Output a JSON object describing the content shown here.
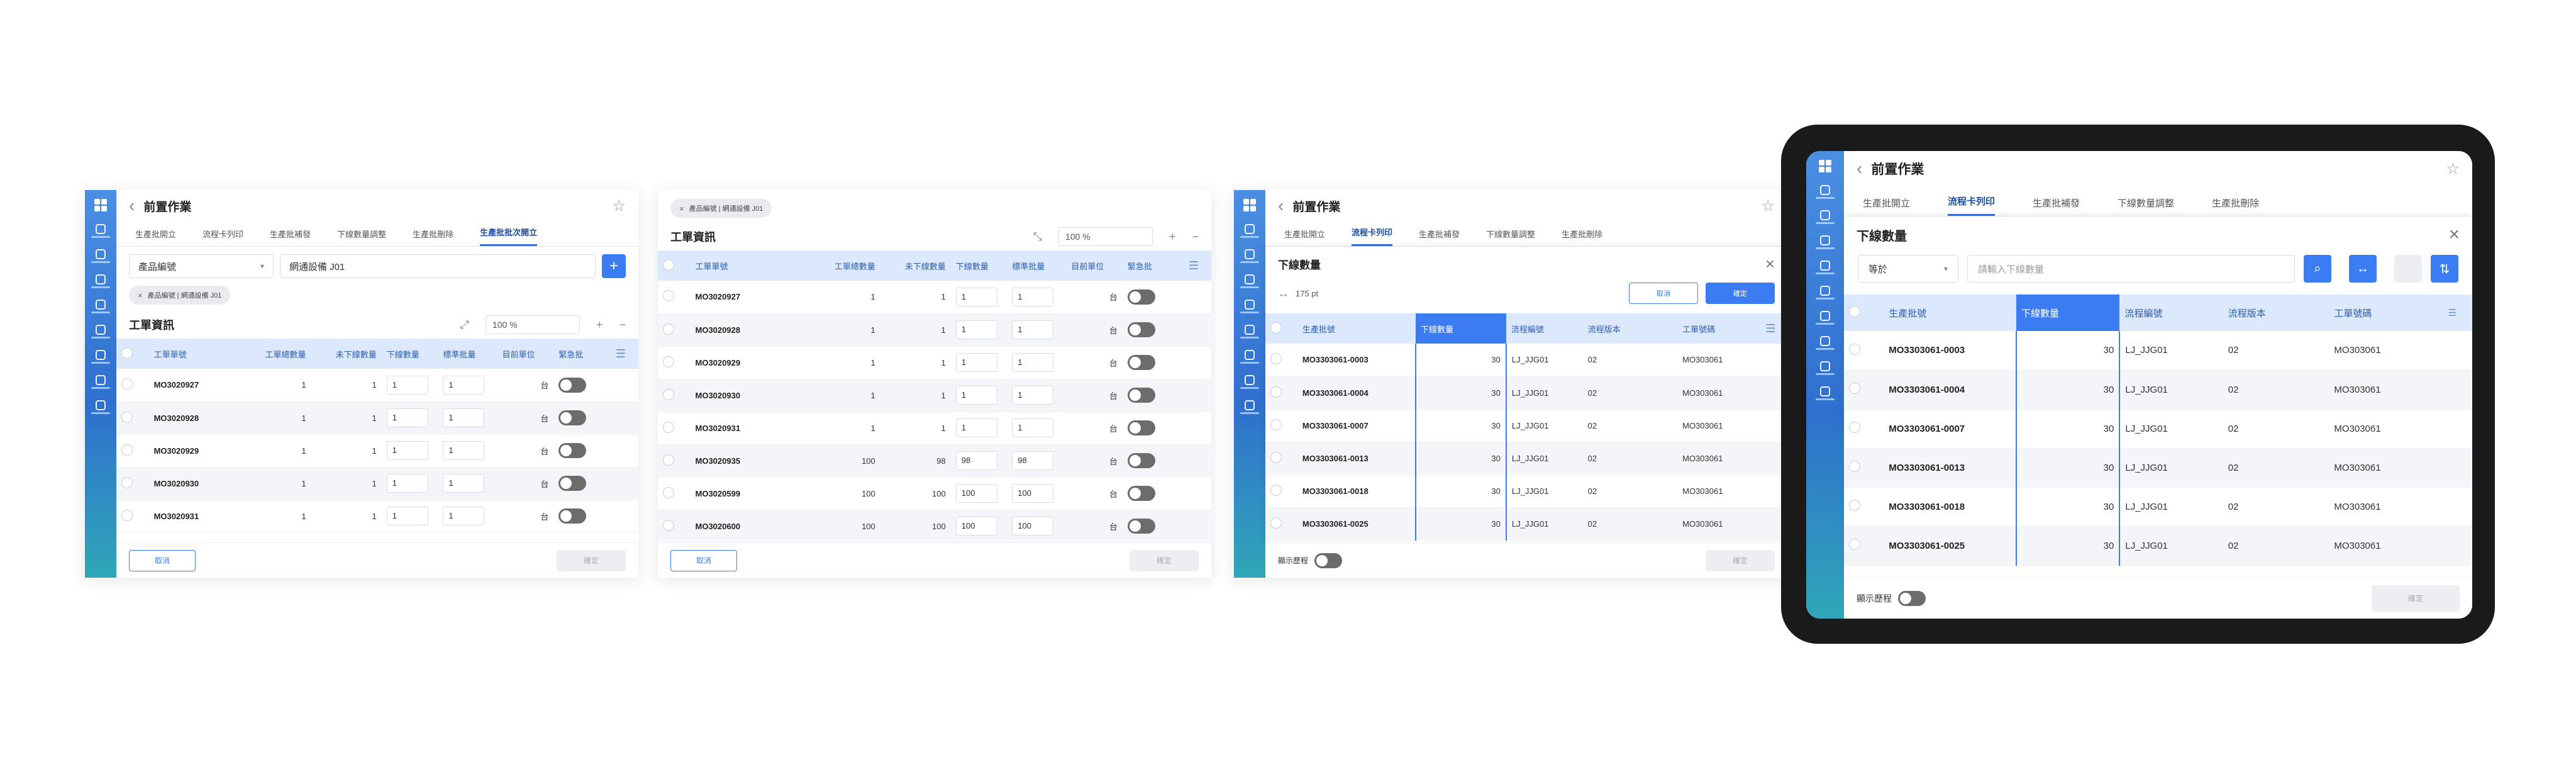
{
  "app": {
    "page_title": "前置作業",
    "tabs": [
      "生產批開立",
      "流程卡列印",
      "生產批補發",
      "下線數量調整",
      "生產批刪除",
      "生產批批次開立"
    ]
  },
  "panel1": {
    "filter_select": "產品編號",
    "filter_value": "網通設備 J01",
    "chip": "產品編號 | 網通設備 J01",
    "section_title": "工單資訊",
    "zoom": "100 %",
    "columns": [
      "工單單號",
      "工單總數量",
      "未下線數量",
      "下線數量",
      "標準批量",
      "目前單位",
      "緊急批"
    ],
    "rows": [
      [
        "MO3020927",
        "1",
        "1",
        "1",
        "1",
        "台"
      ],
      [
        "MO3020928",
        "1",
        "1",
        "1",
        "1",
        "台"
      ],
      [
        "MO3020929",
        "1",
        "1",
        "1",
        "1",
        "台"
      ],
      [
        "MO3020930",
        "1",
        "1",
        "1",
        "1",
        "台"
      ],
      [
        "MO3020931",
        "1",
        "1",
        "1",
        "1",
        "台"
      ]
    ],
    "footer_left": "取消",
    "footer_right": "確定"
  },
  "panel2": {
    "chip": "產品編號 | 網通設備 J01",
    "section_title": "工單資訊",
    "zoom": "100 %",
    "columns": [
      "工單單號",
      "工單總數量",
      "未下線數量",
      "下線數量",
      "標準批量",
      "目前單位",
      "緊急批"
    ],
    "rows": [
      [
        "MO3020927",
        "1",
        "1",
        "1",
        "1",
        "台"
      ],
      [
        "MO3020928",
        "1",
        "1",
        "1",
        "1",
        "台"
      ],
      [
        "MO3020929",
        "1",
        "1",
        "1",
        "1",
        "台"
      ],
      [
        "MO3020930",
        "1",
        "1",
        "1",
        "1",
        "台"
      ],
      [
        "MO3020931",
        "1",
        "1",
        "1",
        "1",
        "台"
      ],
      [
        "MO3020935",
        "100",
        "98",
        "98",
        "98",
        "台"
      ],
      [
        "MO3020599",
        "100",
        "100",
        "100",
        "100",
        "台"
      ],
      [
        "MO3020600",
        "100",
        "100",
        "100",
        "100",
        "台"
      ]
    ],
    "footer_left": "取消",
    "footer_right": "確定"
  },
  "panel3": {
    "qty_title": "下線數量",
    "width_value": "175 pt",
    "cancel": "取消",
    "confirm": "確定",
    "columns": [
      "生產批號",
      "下線數量",
      "流程編號",
      "流程版本",
      "工單號碼"
    ],
    "rows": [
      [
        "MO3303061-0003",
        "30",
        "LJ_JJG01",
        "02",
        "MO303061"
      ],
      [
        "MO3303061-0004",
        "30",
        "LJ_JJG01",
        "02",
        "MO303061"
      ],
      [
        "MO3303061-0007",
        "30",
        "LJ_JJG01",
        "02",
        "MO303061"
      ],
      [
        "MO3303061-0013",
        "30",
        "LJ_JJG01",
        "02",
        "MO303061"
      ],
      [
        "MO3303061-0018",
        "30",
        "LJ_JJG01",
        "02",
        "MO303061"
      ],
      [
        "MO3303061-0025",
        "30",
        "LJ_JJG01",
        "02",
        "MO303061"
      ]
    ],
    "history": "顯示歷程",
    "footer_right": "確定"
  },
  "tablet": {
    "qty_title": "下線數量",
    "op_select": "等於",
    "search_placeholder": "請輸入下線數量",
    "columns": [
      "生產批號",
      "下線數量",
      "流程編號",
      "流程版本",
      "工單號碼"
    ],
    "rows": [
      [
        "MO3303061-0003",
        "30",
        "LJ_JJG01",
        "02",
        "MO303061"
      ],
      [
        "MO3303061-0004",
        "30",
        "LJ_JJG01",
        "02",
        "MO303061"
      ],
      [
        "MO3303061-0007",
        "30",
        "LJ_JJG01",
        "02",
        "MO303061"
      ],
      [
        "MO3303061-0013",
        "30",
        "LJ_JJG01",
        "02",
        "MO303061"
      ],
      [
        "MO3303061-0018",
        "30",
        "LJ_JJG01",
        "02",
        "MO303061"
      ],
      [
        "MO3303061-0025",
        "30",
        "LJ_JJG01",
        "02",
        "MO303061"
      ]
    ],
    "history": "顯示歷程",
    "footer_right": "確定"
  },
  "icons": {
    "back": "chevron-left-icon",
    "favorite": "star-icon",
    "close": "close-icon",
    "search": "search-icon",
    "menu": "hamburger-icon"
  },
  "colors": {
    "accent": "#3b7cf2",
    "header_bg": "#dce8fb",
    "sidebar_top": "#4a8fe3",
    "sidebar_bottom": "#2fa7b8"
  }
}
